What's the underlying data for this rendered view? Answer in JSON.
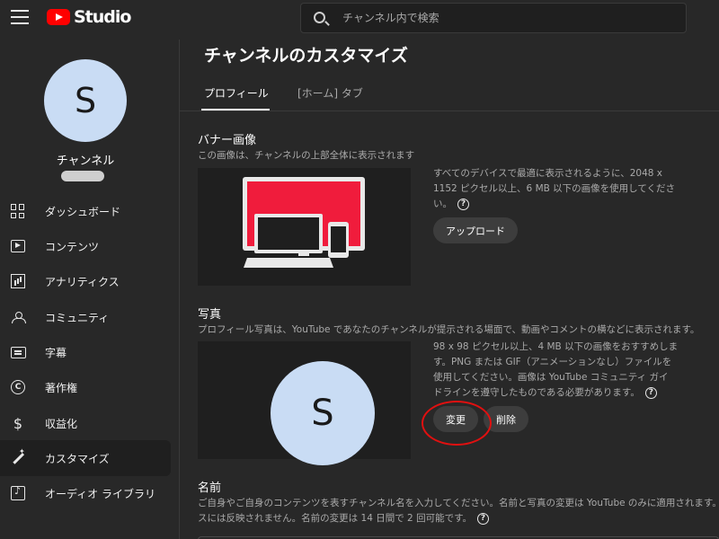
{
  "header": {
    "logo_text": "Studio",
    "search_placeholder": "チャンネル内で検索"
  },
  "sidebar": {
    "avatar_letter": "S",
    "channel_label": "チャンネル",
    "items": [
      {
        "label": "ダッシュボード",
        "icon": "dashboard-icon"
      },
      {
        "label": "コンテンツ",
        "icon": "content-icon"
      },
      {
        "label": "アナリティクス",
        "icon": "analytics-icon"
      },
      {
        "label": "コミュニティ",
        "icon": "community-icon"
      },
      {
        "label": "字幕",
        "icon": "subtitles-icon"
      },
      {
        "label": "著作権",
        "icon": "copyright-icon"
      },
      {
        "label": "収益化",
        "icon": "monetization-icon"
      },
      {
        "label": "カスタマイズ",
        "icon": "customization-icon",
        "active": true
      },
      {
        "label": "オーディオ ライブラリ",
        "icon": "audio-library-icon"
      }
    ]
  },
  "main": {
    "title": "チャンネルのカスタマイズ",
    "tabs": [
      {
        "label": "プロフィール",
        "active": true
      },
      {
        "label": "[ホーム] タブ",
        "active": false
      }
    ],
    "banner": {
      "title": "バナー画像",
      "description": "この画像は、チャンネルの上部全体に表示されます",
      "help_line1": "すべてのデバイスで最適に表示されるように、2048 x",
      "help_line2": "1152 ピクセル以上、6 MB 以下の画像を使用してくださ",
      "help_line3": "い。",
      "upload_button": "アップロード"
    },
    "photo": {
      "title": "写真",
      "description": "プロフィール写真は、YouTube であなたのチャンネルが提示される場面で、動画やコメントの横などに表示されます。",
      "avatar_letter": "S",
      "help_line1": "98 x 98 ピクセル以上、4 MB 以下の画像をおすすめしま",
      "help_line2": "す。PNG または GIF（アニメーションなし）ファイルを",
      "help_line3": "使用してください。画像は YouTube コミュニティ ガイ",
      "help_line4": "ドラインを遵守したものである必要があります。",
      "change_button": "変更",
      "delete_button": "削除"
    },
    "name": {
      "title": "名前",
      "description_line1": "ご自身やご自身のコンテンツを表すチャンネル名を入力してください。名前と写真の変更は YouTube のみに適用されます。",
      "description_line2": "スには反映されません。名前の変更は 14 日間で 2 回可能です。"
    }
  },
  "colors": {
    "accent_red": "#ff0000",
    "annotation_red": "#e01010",
    "avatar_bg": "#c9dcf4",
    "background": "#282828"
  }
}
